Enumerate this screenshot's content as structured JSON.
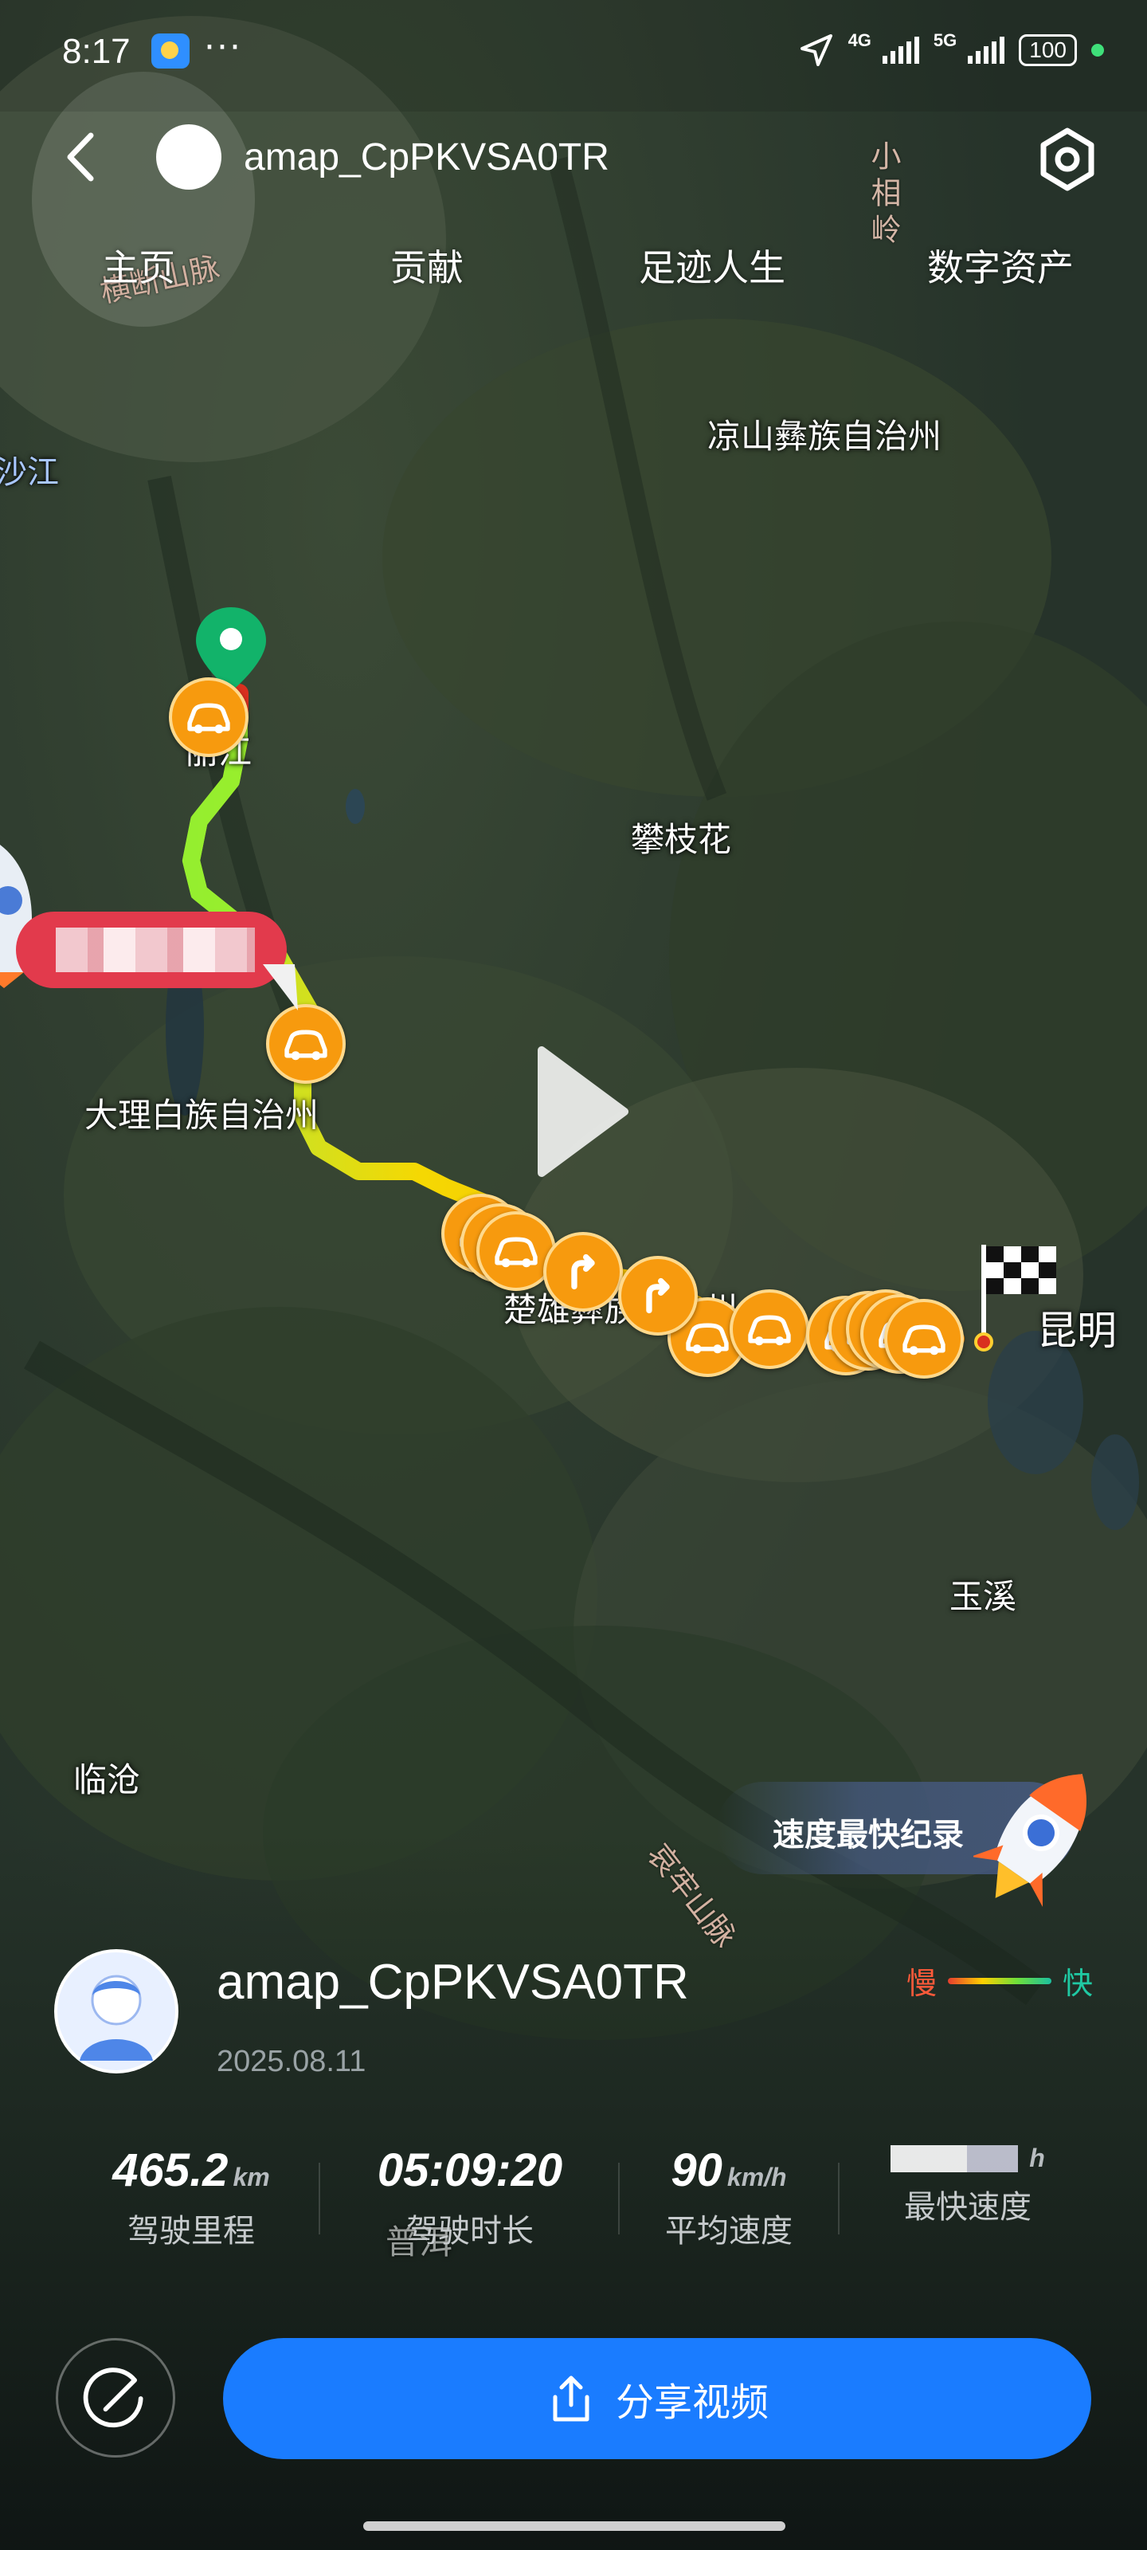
{
  "status_bar": {
    "time": "8:17",
    "dots": "···",
    "net1": "4G",
    "net2": "5G",
    "battery": "100"
  },
  "header": {
    "title": "amap_CpPKVSA0TR"
  },
  "tabs": [
    "主页",
    "贡献",
    "足迹人生",
    "数字资产"
  ],
  "map": {
    "labels": {
      "liangshan": "凉山彝族自治州",
      "panzhihua": "攀枝花",
      "lijiang": "丽江",
      "dali": "大理白族自治州",
      "chuxiong": "楚雄彝族自治州",
      "kunming": "昆明",
      "yuxi": "玉溪",
      "lincang": "临沧",
      "puer": "普洱",
      "river": "沙江",
      "hengduan": "横断山脉",
      "xiaoxiang": "小相岭",
      "ailao": "哀牢山脉"
    }
  },
  "record": {
    "label": "速度最快纪录"
  },
  "legend": {
    "slow": "慢",
    "fast": "快",
    "slow_color": "#ff5a3a",
    "fast_color": "#1fc9a3"
  },
  "user": {
    "name": "amap_CpPKVSA0TR",
    "date": "2025.08.11"
  },
  "stats": {
    "distance": {
      "value": "465.2",
      "unit": "km",
      "label": "驾驶里程"
    },
    "duration": {
      "value": "05:09:20",
      "unit": "",
      "label": "驾驶时长"
    },
    "avg_speed": {
      "value": "90",
      "unit": "km/h",
      "label": "平均速度"
    },
    "max_speed": {
      "value": "",
      "unit": "h",
      "label": "最快速度"
    }
  },
  "share": {
    "label": "分享视频",
    "color": "#1a7cff"
  }
}
